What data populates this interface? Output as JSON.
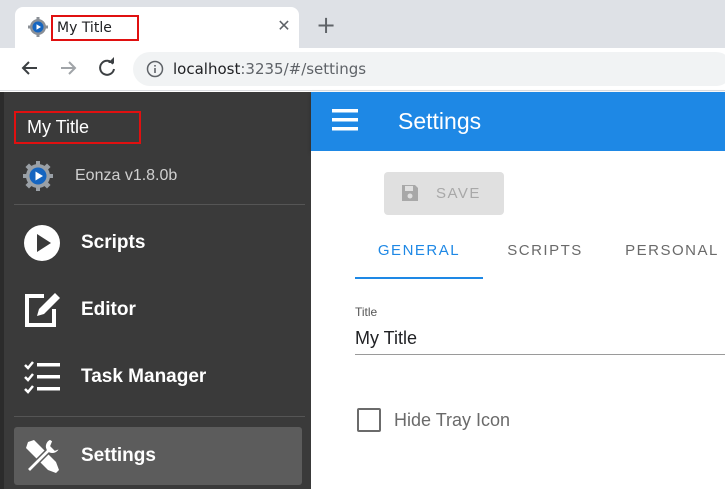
{
  "browser": {
    "tab_title": "My Title",
    "tab_close": "✕",
    "new_tab": "+",
    "url_host": "localhost",
    "url_rest": ":3235/#/settings"
  },
  "sidebar": {
    "title": "My Title",
    "version": "Eonza v1.8.0b",
    "items": [
      {
        "label": "Scripts",
        "icon": "play-circle-icon"
      },
      {
        "label": "Editor",
        "icon": "edit-icon"
      },
      {
        "label": "Task Manager",
        "icon": "checklist-icon"
      },
      {
        "label": "Settings",
        "icon": "tools-icon",
        "active": true
      }
    ]
  },
  "appbar": {
    "title": "Settings"
  },
  "main": {
    "save_label": "SAVE",
    "tabs": [
      {
        "label": "GENERAL",
        "active": true
      },
      {
        "label": "SCRIPTS"
      },
      {
        "label": "PERSONAL"
      }
    ],
    "title_field": {
      "label": "Title",
      "value": "My Title"
    },
    "hide_tray": {
      "label": "Hide Tray Icon",
      "checked": false
    }
  },
  "colors": {
    "accent": "#1e88e5",
    "sidebar_bg": "#3a3a3a",
    "highlight_box": "#e01010"
  }
}
